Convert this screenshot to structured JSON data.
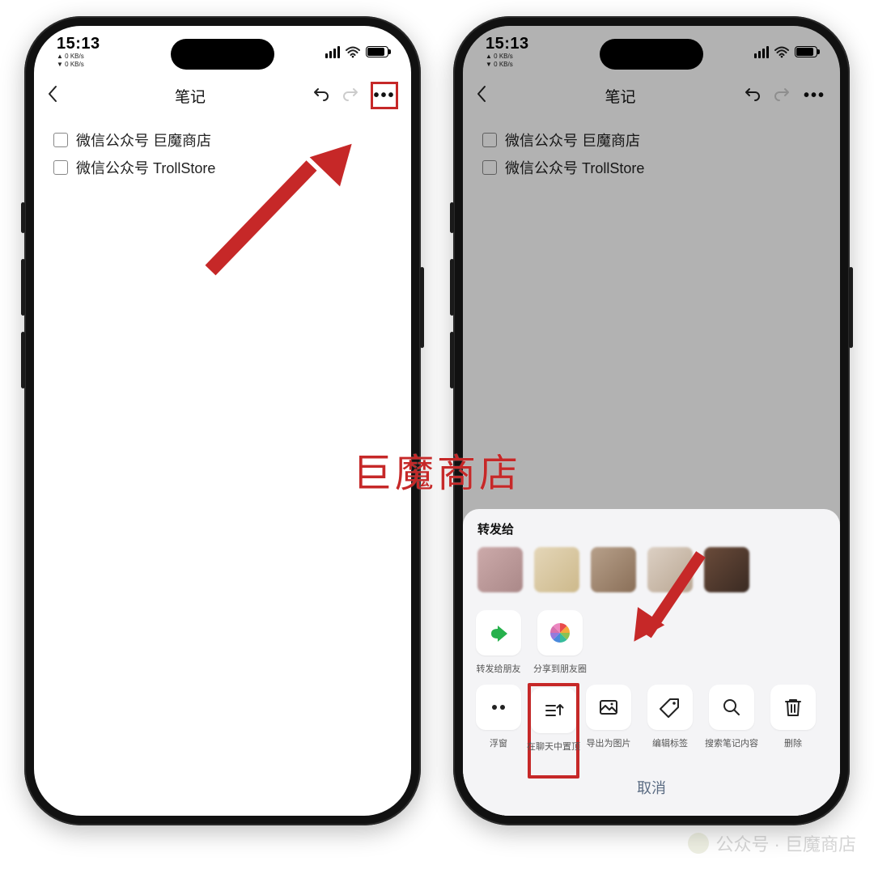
{
  "status": {
    "time": "15:13",
    "kbs_up": "▲ 0 KB/s",
    "kbs_dn": "▼ 0 KB/s"
  },
  "nav": {
    "title": "笔记",
    "more": "•••"
  },
  "note": {
    "items": [
      {
        "text": "微信公众号 巨魔商店"
      },
      {
        "text": "微信公众号 TrollStore"
      }
    ]
  },
  "sheet": {
    "forward_to": "转发给",
    "row1": [
      {
        "id": "share-friend",
        "label": "转发给朋友"
      },
      {
        "id": "share-moments",
        "label": "分享到朋友圈"
      }
    ],
    "row2": [
      {
        "id": "float-window",
        "label": "浮窗"
      },
      {
        "id": "pin-in-chat",
        "label": "在聊天中置顶"
      },
      {
        "id": "export-image",
        "label": "导出为图片"
      },
      {
        "id": "edit-tags",
        "label": "编辑标签"
      },
      {
        "id": "search-note",
        "label": "搜索笔记内容"
      },
      {
        "id": "delete",
        "label": "删除"
      }
    ],
    "cancel": "取消"
  },
  "watermark": {
    "center": "巨魔商店",
    "br": "公众号 · 巨魔商店"
  }
}
